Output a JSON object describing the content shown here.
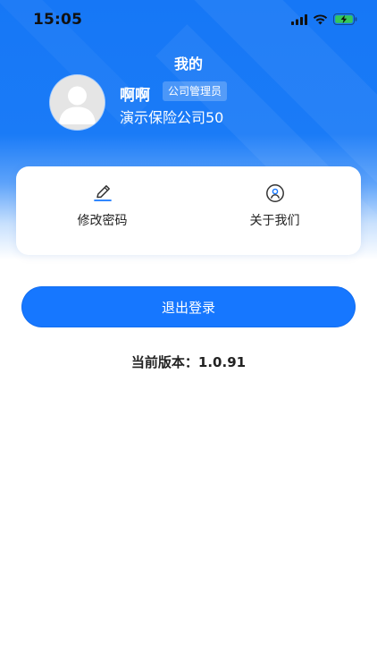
{
  "status_bar": {
    "time": "15:05",
    "icons": [
      "signal-icon",
      "wifi-icon",
      "battery-charging-icon"
    ]
  },
  "header": {
    "title": "我的"
  },
  "profile": {
    "name": "啊啊",
    "role": "公司管理员",
    "company": "演示保险公司50",
    "avatar_icon": "avatar-placeholder-icon"
  },
  "actions": [
    {
      "label": "修改密码",
      "icon": "edit-pen-icon"
    },
    {
      "label": "关于我们",
      "icon": "user-circle-icon"
    }
  ],
  "logout": {
    "label": "退出登录"
  },
  "version": {
    "label": "当前版本：",
    "value": "1.0.91"
  },
  "colors": {
    "primary": "#1677ff",
    "header_gradient_top": "#1677f6",
    "battery_charging": "#34c759",
    "text_dark": "#222222"
  }
}
